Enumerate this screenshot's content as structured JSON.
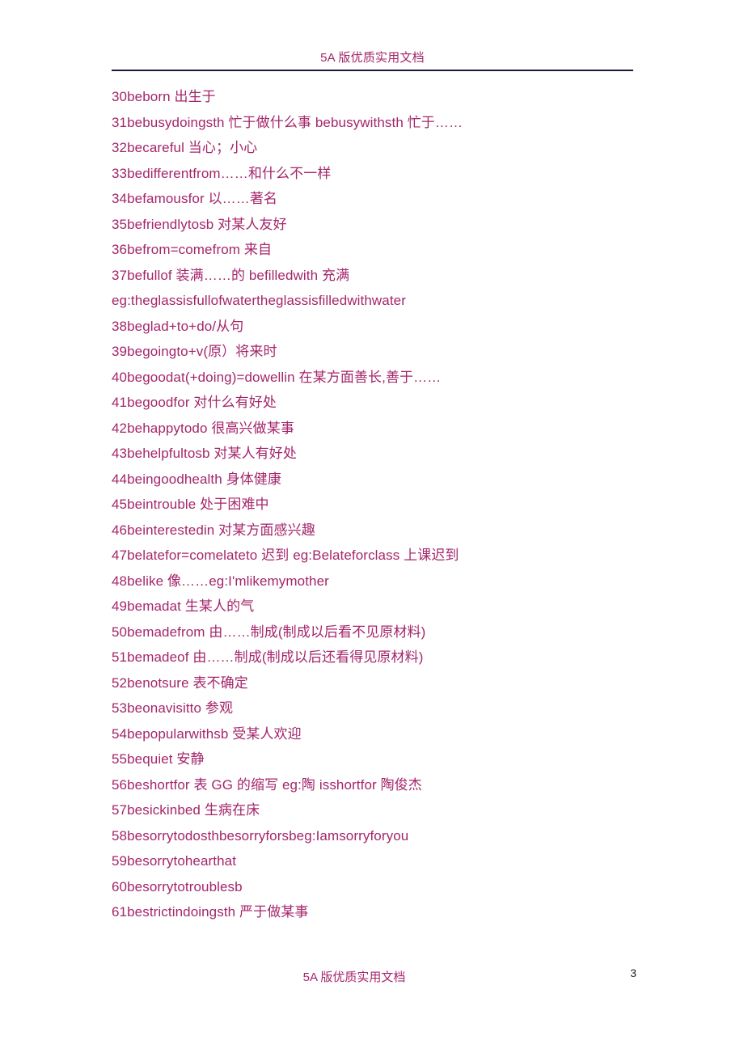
{
  "header": {
    "title": "5A 版优质实用文档"
  },
  "footer": {
    "title": "5A 版优质实用文档",
    "page_number": "3"
  },
  "colors": {
    "text": "#a4266b",
    "rule": "#1b1b38",
    "page_number": "#262626",
    "background": "#ffffff"
  },
  "content": {
    "entries": [
      {
        "text": "30beborn 出生于"
      },
      {
        "text": "31bebusydoingsth 忙于做什么事 bebusywithsth 忙于……"
      },
      {
        "text": "32becareful 当心；小心"
      },
      {
        "text": "33bedifferentfrom……和什么不一样"
      },
      {
        "text": "34befamousfor 以……著名"
      },
      {
        "text": "35befriendlytosb 对某人友好"
      },
      {
        "text": "36befrom=comefrom 来自"
      },
      {
        "text": "37befullof 装满……的 befilledwith 充满"
      },
      {
        "text": "eg:theglassisfullofwatertheglassisfilledwithwater"
      },
      {
        "text": "38beglad+to+do/从句"
      },
      {
        "text": "39begoingto+v(原）将来时"
      },
      {
        "text": "40begoodat(+doing)=dowellin 在某方面善长,善于……"
      },
      {
        "text": "41begoodfor 对什么有好处"
      },
      {
        "text": "42behappytodo 很高兴做某事"
      },
      {
        "text": "43behelpfultosb 对某人有好处"
      },
      {
        "text": "44beingoodhealth 身体健康"
      },
      {
        "text": "45beintrouble 处于困难中"
      },
      {
        "text": "46beinterestedin 对某方面感兴趣"
      },
      {
        "text": "47belatefor=comelateto 迟到 eg:Belateforclass 上课迟到"
      },
      {
        "text": "48belike 像……eg:I'mlikemymother"
      },
      {
        "text": "49bemadat 生某人的气"
      },
      {
        "text": "50bemadefrom 由……制成(制成以后看不见原材料)"
      },
      {
        "text": "51bemadeof 由……制成(制成以后还看得见原材料)"
      },
      {
        "text": "52benotsure 表不确定"
      },
      {
        "text": "53beonavisitto 参观"
      },
      {
        "text": "54bepopularwithsb 受某人欢迎"
      },
      {
        "text": "55bequiet 安静"
      },
      {
        "text": "56beshortfor 表 GG 的缩写 eg:陶 isshortfor 陶俊杰"
      },
      {
        "text": "57besickinbed 生病在床"
      },
      {
        "text": "58besorrytodosthbesorryforsbeg:Iamsorryforyou"
      },
      {
        "text": "59besorrytohearthat"
      },
      {
        "text": "60besorrytotroublesb"
      },
      {
        "text": "61bestrictindoingsth 严于做某事"
      }
    ]
  }
}
